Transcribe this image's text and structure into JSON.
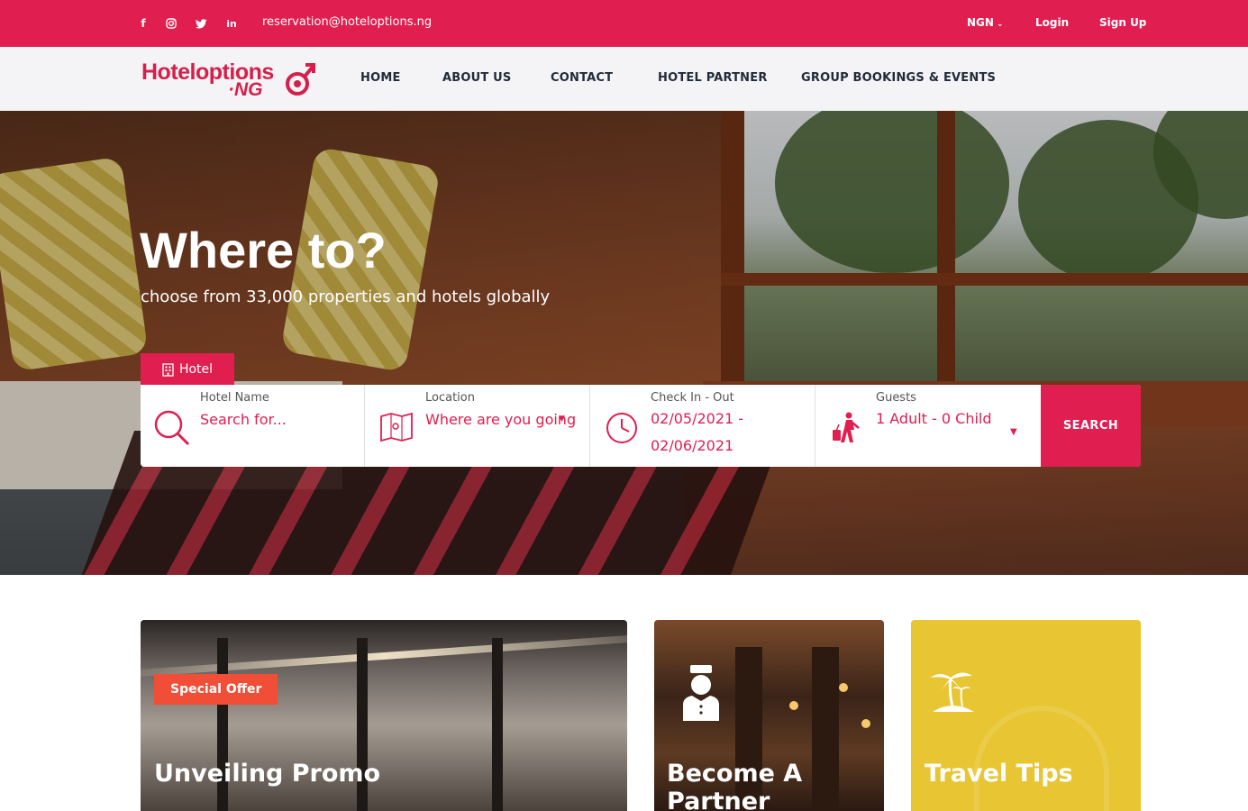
{
  "topbar": {
    "social": [
      {
        "name": "facebook-icon",
        "glyph": "f"
      },
      {
        "name": "instagram-icon",
        "glyph": "◎"
      },
      {
        "name": "twitter-icon",
        "glyph": "🐦"
      },
      {
        "name": "linkedin-icon",
        "glyph": "in"
      }
    ],
    "email": "reservation@hoteloptions.ng",
    "currency": "NGN",
    "login": "Login",
    "signup": "Sign Up"
  },
  "brand": {
    "word1": "Hoteloptions",
    "word2": "·NG",
    "color": "#d61f4a"
  },
  "nav": {
    "items": [
      "HOME",
      "ABOUT US",
      "CONTACT",
      "HOTEL PARTNER",
      "GROUP BOOKINGS & EVENTS"
    ]
  },
  "hero": {
    "title": "Where to?",
    "subtitle": "choose from 33,000 properties and hotels globally"
  },
  "search": {
    "tab_label": "Hotel",
    "hotel_label": "Hotel Name",
    "hotel_placeholder": "Search for...",
    "location_label": "Location",
    "location_placeholder": "Where are you going",
    "dates_label": "Check In - Out",
    "dates_line1": "02/05/2021 -",
    "dates_line2": "02/06/2021",
    "guests_label": "Guests",
    "guests_value": "1 Adult - 0 Child",
    "button": "SEARCH"
  },
  "cards": {
    "promo_badge": "Special Offer",
    "promo_title": "Unveiling Promo",
    "partner_title": "Become A Partner",
    "tips_title": "Travel Tips"
  },
  "colors": {
    "primary": "#e01e4f",
    "badge": "#f04e36",
    "tips_bg": "#e8c532"
  }
}
